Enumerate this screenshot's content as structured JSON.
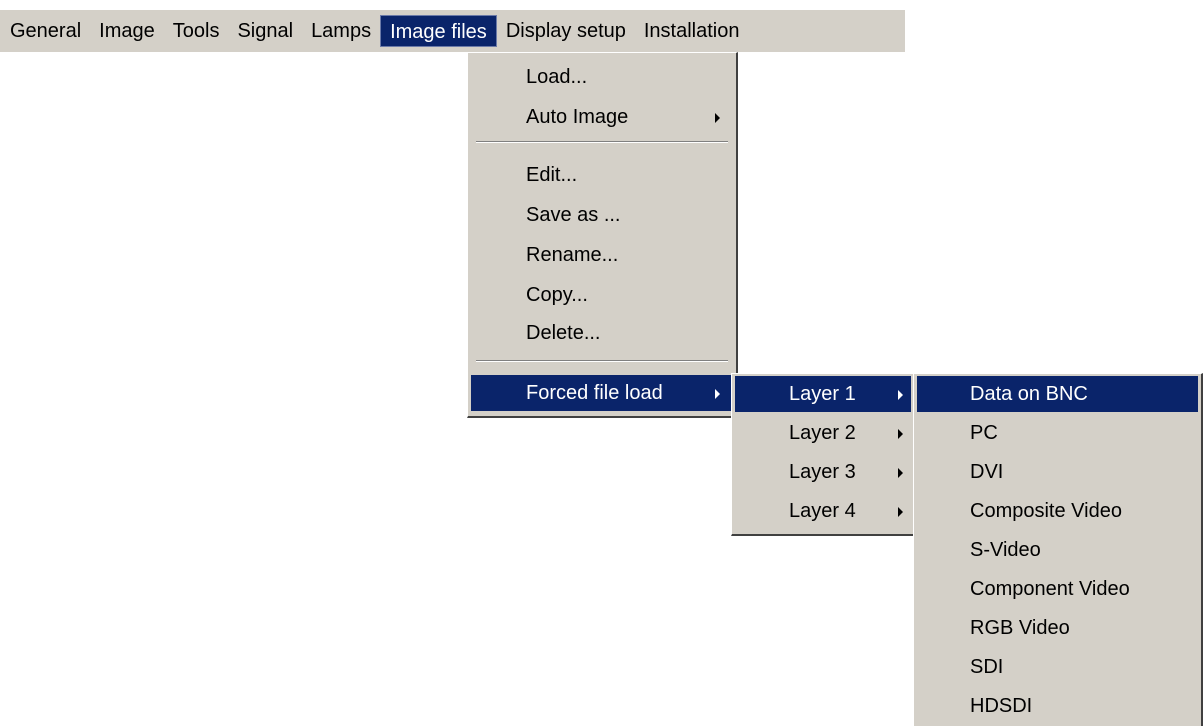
{
  "menubar": {
    "items": [
      {
        "label": "General"
      },
      {
        "label": "Image"
      },
      {
        "label": "Tools"
      },
      {
        "label": "Signal"
      },
      {
        "label": "Lamps"
      },
      {
        "label": "Image files"
      },
      {
        "label": "Display setup"
      },
      {
        "label": "Installation"
      }
    ],
    "active": "Image files"
  },
  "image_files_menu": {
    "load": "Load...",
    "auto_image": "Auto Image",
    "edit": "Edit...",
    "save_as": "Save as ...",
    "rename": "Rename...",
    "copy": "Copy...",
    "delete": "Delete...",
    "forced_file_load": "Forced file load"
  },
  "layers_menu": {
    "items": [
      {
        "label": "Layer 1"
      },
      {
        "label": "Layer 2"
      },
      {
        "label": "Layer 3"
      },
      {
        "label": "Layer 4"
      }
    ],
    "selected": "Layer 1"
  },
  "sources_menu": {
    "items": [
      {
        "label": "Data on BNC"
      },
      {
        "label": "PC"
      },
      {
        "label": "DVI"
      },
      {
        "label": "Composite Video"
      },
      {
        "label": "S-Video"
      },
      {
        "label": "Component Video"
      },
      {
        "label": "RGB Video"
      },
      {
        "label": "SDI"
      },
      {
        "label": "HDSDI"
      }
    ],
    "selected": "Data on BNC"
  },
  "colors": {
    "menu_background": "#d4d0c8",
    "highlight": "#0a246a",
    "highlight_text": "#ffffff"
  }
}
